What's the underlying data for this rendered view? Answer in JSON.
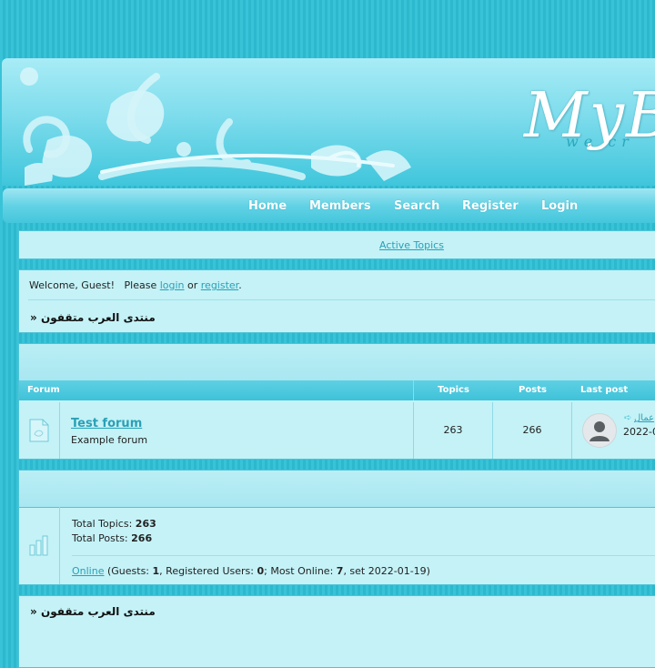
{
  "header": {
    "logo_text": "MyB",
    "tagline": "we cr"
  },
  "nav": {
    "items": [
      {
        "label": "Home"
      },
      {
        "label": "Members"
      },
      {
        "label": "Search"
      },
      {
        "label": "Register"
      },
      {
        "label": "Login"
      }
    ]
  },
  "topbar": {
    "active_topics": "Active Topics"
  },
  "welcome": {
    "prefix": "Welcome, Guest!   Please ",
    "login": "login",
    "or": " or ",
    "register": "register",
    "suffix": "."
  },
  "breadcrumb": {
    "arrow": "»",
    "forum_name": "منتدى العرب متقفون"
  },
  "forum_table": {
    "headers": {
      "forum": "Forum",
      "topics": "Topics",
      "posts": "Posts",
      "last_post": "Last post"
    },
    "rows": [
      {
        "title": "Test forum",
        "description": "Example forum",
        "topics": "263",
        "posts": "266",
        "last_post_title": "عمال",
        "last_post_date": "2022-0"
      }
    ]
  },
  "stats": {
    "total_topics_label": "Total Topics: ",
    "total_topics": "263",
    "total_posts_label": "Total Posts: ",
    "total_posts": "266",
    "online_link": "Online",
    "guests_label": " (Guests: ",
    "guests": "1",
    "registered_label": ", Registered Users: ",
    "registered": "0",
    "most_online_label": "; Most Online: ",
    "most_online": "7",
    "set_label": ", set 2022-01-19)"
  },
  "colors": {
    "page_bg": "#38c3d8",
    "box_bg": "#c4f2f7",
    "box_border": "#4fc4d6",
    "link": "#2aa0b6"
  }
}
